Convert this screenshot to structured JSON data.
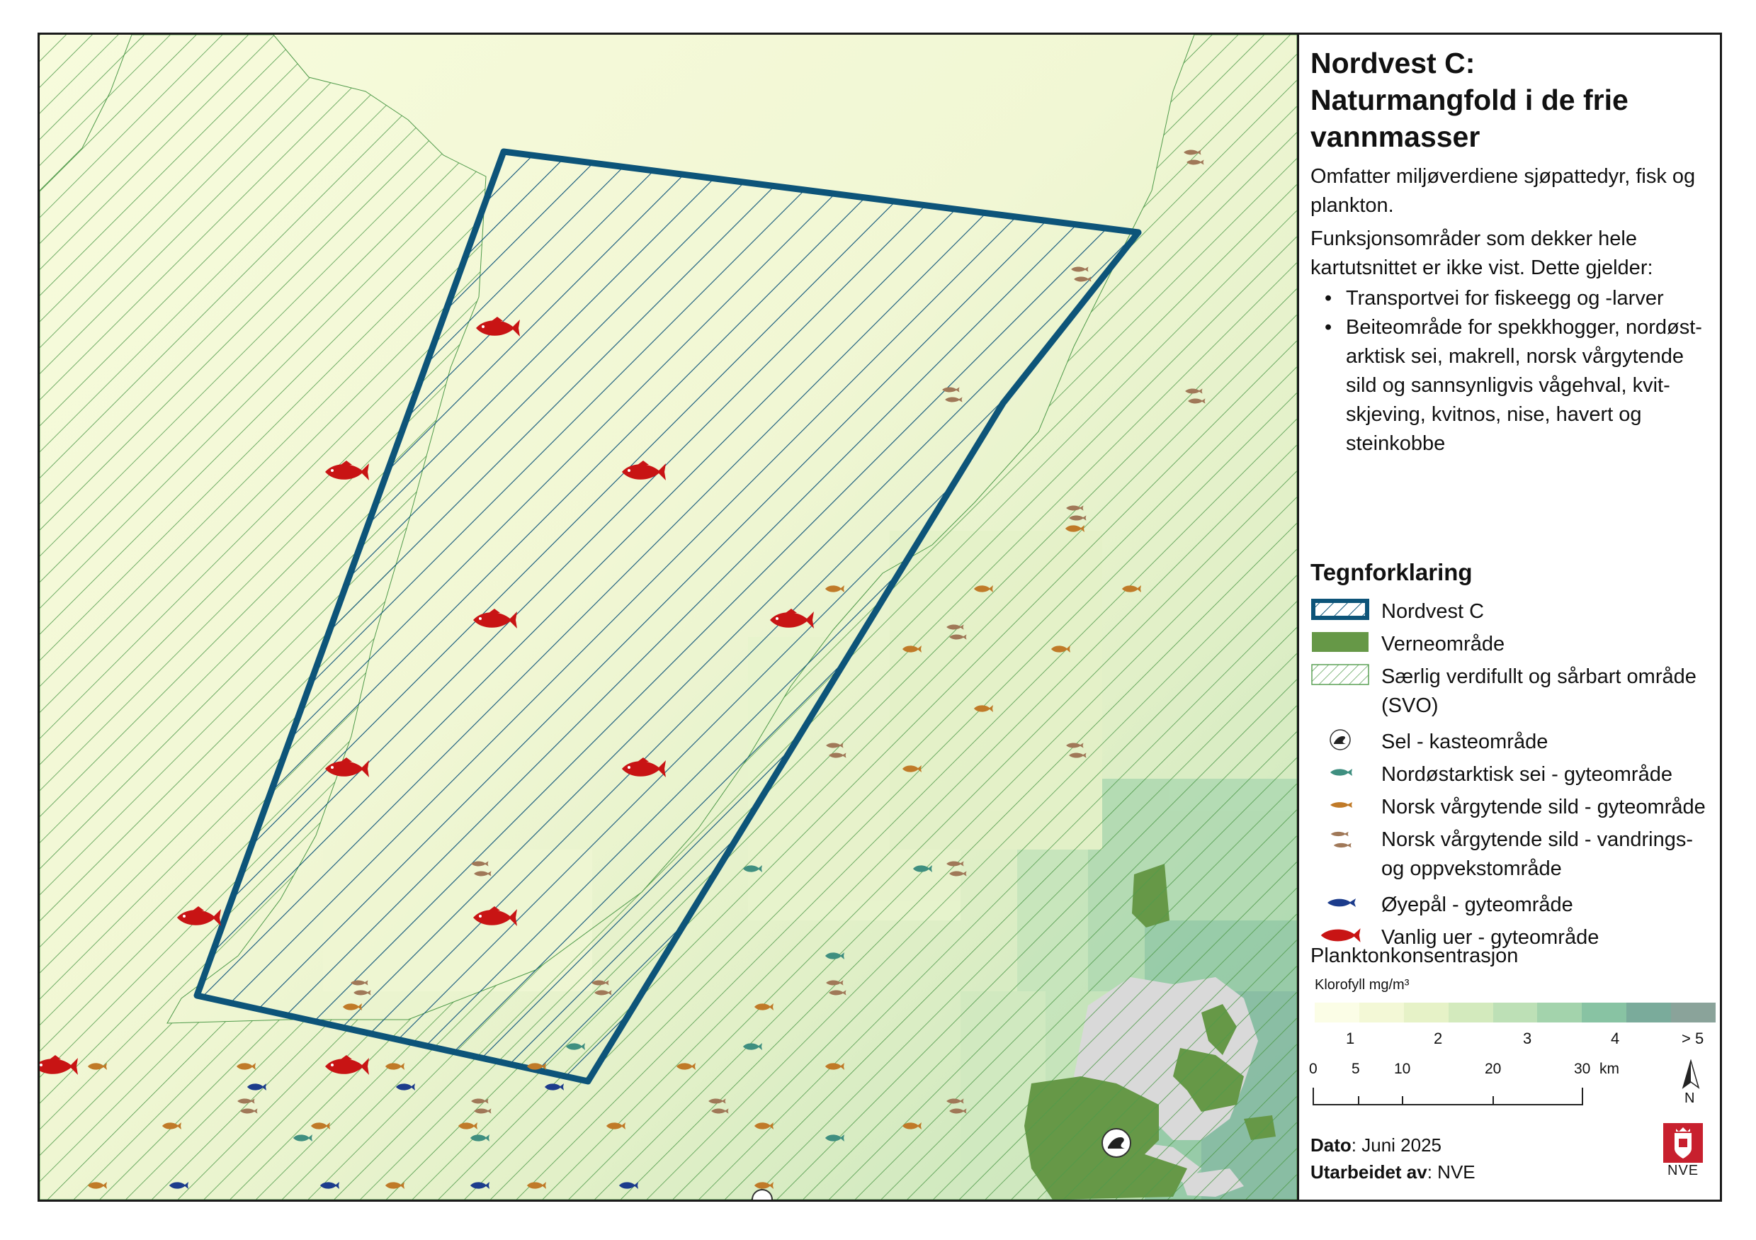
{
  "panel": {
    "title": "Nordvest C: Naturmangfold i de frie vannmasser",
    "description": "Omfatter miljøverdiene sjøpattedyr, fisk og plankton.",
    "note": "Funksjonsområder som dekker hele kartutsnittet er ikke vist. Dette gjelder:",
    "bullets": [
      "Transportvei for fiskeegg og -larver",
      "Beiteområde for spekkhogger, nordøst-arktisk sei, makrell, norsk vårgytende sild og sannsynligvis vågehval, kvit-skjeving, kvitnos, nise, havert og steinkobbe"
    ]
  },
  "legend": {
    "heading": "Tegnforklaring",
    "items": [
      {
        "label": "Nordvest C",
        "symbol": "study-area-hatched-outline"
      },
      {
        "label": "Verneområde",
        "symbol": "protected-area-fill"
      },
      {
        "label": "Særlig verdifullt og sårbart område (SVO)",
        "symbol": "svo-hatch"
      },
      {
        "label": "Sel - kasteområde",
        "symbol": "seal-icon"
      },
      {
        "label": "Nordøstarktisk sei - gyteområde",
        "symbol": "saithe-icon"
      },
      {
        "label": "Norsk vårgytende sild - gyteområde",
        "symbol": "herring-spawning-icon"
      },
      {
        "label": "Norsk vårgytende sild - vandrings- og oppvekstområde",
        "symbol": "herring-migration-icon"
      },
      {
        "label": "Øyepål - gyteområde",
        "symbol": "norway-pout-icon"
      },
      {
        "label": "Vanlig uer - gyteområde",
        "symbol": "redfish-icon"
      }
    ]
  },
  "plankton": {
    "heading": "Planktonkonsentrasjon",
    "unit": "Klorofyll mg/m³",
    "tick_labels": [
      "1",
      "2",
      "3",
      "4",
      "> 5"
    ],
    "colors": [
      "#fbfde6",
      "#f3f8d6",
      "#e6f2c7",
      "#d3eabd",
      "#bde0b6",
      "#a3d3ac",
      "#88c3a3",
      "#7aab9b",
      "#8aa39a"
    ]
  },
  "scale_bar": {
    "labels": [
      "0",
      "5",
      "10",
      "20",
      "30"
    ],
    "unit": "km"
  },
  "north_label": "N",
  "footer": {
    "dato_label": "Dato",
    "dato_value": ": Juni 2025",
    "author_label": "Utarbeidet av",
    "author_value": ": NVE"
  },
  "logo_text": "NVE",
  "colors": {
    "study_area": "#0d5479",
    "svo_hatch": "#4f9a4a",
    "protected_area": "#669847",
    "redfish": "#c81414",
    "saithe": "#3f8f80",
    "herring": "#c07a28",
    "pout": "#1c3c8c",
    "land": "#d9d9d9"
  }
}
